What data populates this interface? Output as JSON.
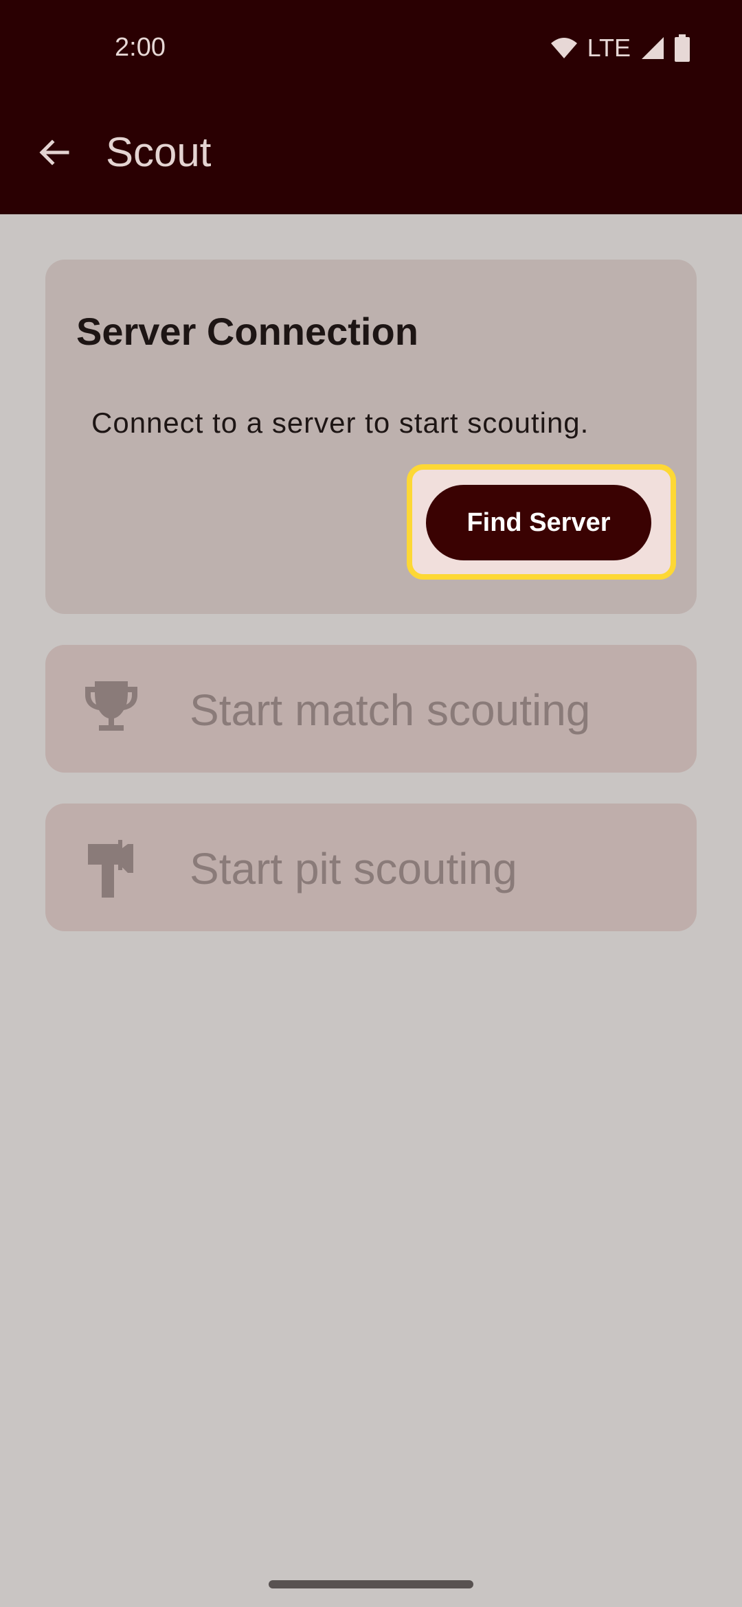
{
  "status_bar": {
    "time": "2:00",
    "network": "LTE",
    "icons": [
      "wifi-icon",
      "signal-icon",
      "battery-icon"
    ]
  },
  "app_bar": {
    "back_icon": "arrow-back-icon",
    "title": "Scout"
  },
  "server_card": {
    "title": "Server Connection",
    "description": "Connect to a server to start scouting.",
    "button_label": "Find Server"
  },
  "actions": [
    {
      "icon": "trophy-icon",
      "label": "Start match scouting"
    },
    {
      "icon": "hammer-icon",
      "label": "Start pit scouting"
    }
  ],
  "colors": {
    "top_bar": "#2a0002",
    "background": "#c9c5c3",
    "accent_button": "#3a0202",
    "highlight": "#fdd835"
  }
}
